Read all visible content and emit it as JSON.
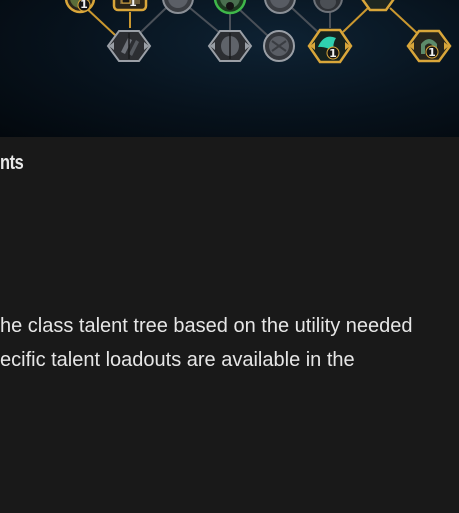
{
  "talent_tree": {
    "colors": {
      "selected_border": "#d9a63a",
      "unselected_border": "#8a8f96",
      "selected_link": "#c9972f",
      "unselected_link": "#4a5058",
      "green_node": "#3fb84a",
      "teal_glow": "#2fd0b0"
    },
    "nodes": [
      {
        "name": "talent-node-gold-1",
        "shape": "circle",
        "state": "selected",
        "rank": "1"
      },
      {
        "name": "talent-node-gold-2",
        "shape": "square",
        "state": "selected",
        "rank": "1"
      },
      {
        "name": "talent-node-gray-1",
        "shape": "circle",
        "state": "unselected",
        "rank": ""
      },
      {
        "name": "talent-node-green",
        "shape": "circle",
        "state": "selected-green",
        "rank": ""
      },
      {
        "name": "talent-node-gray-2",
        "shape": "circle",
        "state": "unselected",
        "rank": ""
      },
      {
        "name": "talent-node-gray-3",
        "shape": "circle",
        "state": "unselected",
        "rank": ""
      },
      {
        "name": "talent-node-teal-top",
        "shape": "octagon",
        "state": "selected",
        "rank": ""
      },
      {
        "name": "talent-node-choice-1",
        "shape": "octagon",
        "state": "unselected",
        "rank": ""
      },
      {
        "name": "talent-node-choice-2",
        "shape": "octagon",
        "state": "unselected",
        "rank": ""
      },
      {
        "name": "talent-node-gray-4",
        "shape": "circle",
        "state": "unselected",
        "rank": ""
      },
      {
        "name": "talent-node-teal-choice",
        "shape": "octagon",
        "state": "selected",
        "rank": "1"
      },
      {
        "name": "talent-node-arch-choice",
        "shape": "octagon",
        "state": "selected",
        "rank": "1"
      }
    ]
  },
  "section": {
    "heading": "nts",
    "paragraph_lines": [
      "he class talent tree based on the utility needed",
      "ecific talent loadouts are available in the"
    ]
  }
}
